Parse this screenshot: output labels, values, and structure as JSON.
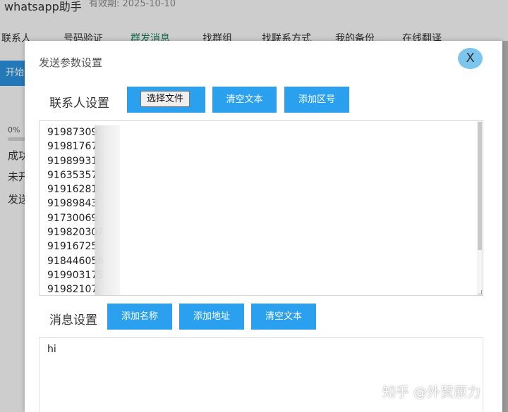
{
  "app": {
    "title": "whatsapp助手",
    "validity": "有效期: 2025-10-10",
    "menu": [
      "联系人",
      "号码验证",
      "群发消息",
      "找群组",
      "找联系方式",
      "我的备份",
      "在线翻译"
    ],
    "start_label": "开始",
    "progress_text": "0%",
    "status_lines": [
      "成功",
      "未开",
      "发送"
    ]
  },
  "modal": {
    "title": "发送参数设置",
    "close_label": "X",
    "contacts": {
      "label": "联系人设置",
      "file_button": "选择文件",
      "clear_button": "清空文本",
      "add_code_button": "添加区号",
      "numbers": [
        "91987309",
        "91981767",
        "91989931",
        "91635357",
        "91916281",
        "91989843",
        "91730069",
        "919820307",
        "91916725",
        "918446056",
        "919903175",
        "91982107"
      ]
    },
    "message": {
      "label": "消息设置",
      "add_name_button": "添加名称",
      "add_address_button": "添加地址",
      "clear_button": "清空文本",
      "text": "hi"
    }
  },
  "watermark": "知乎 @外贸原力",
  "colors": {
    "button_blue": "#2aa0ef",
    "close_blue": "#7cc5ec",
    "active_menu": "#1a7f5a"
  }
}
